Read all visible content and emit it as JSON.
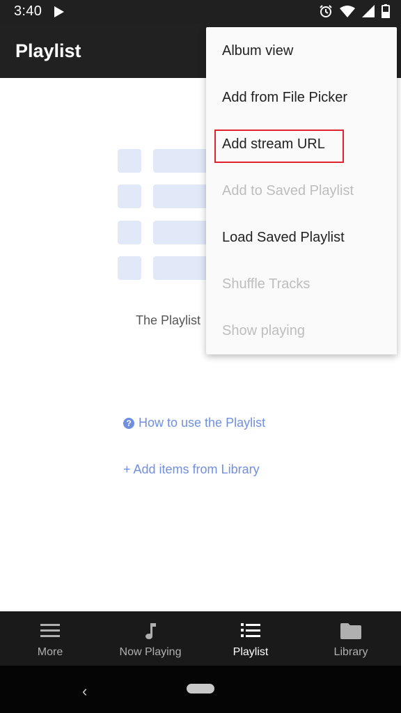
{
  "status_bar": {
    "time": "3:40",
    "icons": [
      "play-icon",
      "alarm-icon",
      "wifi-icon",
      "signal-icon",
      "battery-icon"
    ]
  },
  "app_bar": {
    "title": "Playlist"
  },
  "empty_state": {
    "message": "The Playlist",
    "help_link": "How to use the Playlist",
    "add_link": "+ Add items from Library",
    "link_color": "#6f8fe0"
  },
  "menu": {
    "items": [
      {
        "label": "Album view",
        "enabled": true
      },
      {
        "label": "Add from File Picker",
        "enabled": true
      },
      {
        "label": "Add stream URL",
        "enabled": true,
        "highlighted": true
      },
      {
        "label": "Add to Saved Playlist",
        "enabled": false
      },
      {
        "label": "Load Saved Playlist",
        "enabled": true
      },
      {
        "label": "Shuffle Tracks",
        "enabled": false
      },
      {
        "label": "Show playing",
        "enabled": false
      }
    ],
    "highlight_color": "#e0242e"
  },
  "bottom_nav": {
    "items": [
      {
        "label": "More",
        "icon": "menu-icon",
        "active": false
      },
      {
        "label": "Now Playing",
        "icon": "music-note-icon",
        "active": false
      },
      {
        "label": "Playlist",
        "icon": "list-icon",
        "active": true
      },
      {
        "label": "Library",
        "icon": "folder-icon",
        "active": false
      }
    ]
  },
  "system_nav": {
    "icons": [
      "back-icon",
      "home-icon"
    ]
  }
}
